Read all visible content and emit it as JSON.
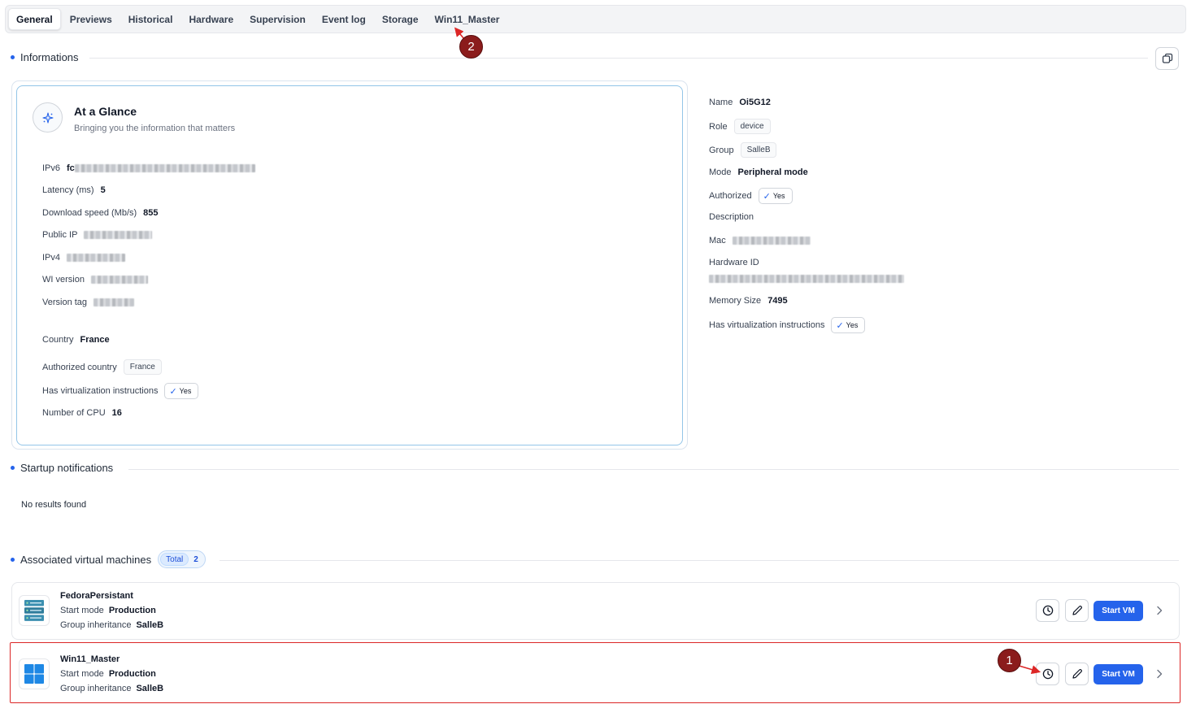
{
  "tabs": [
    "General",
    "Previews",
    "Historical",
    "Hardware",
    "Supervision",
    "Event log",
    "Storage",
    "Win11_Master"
  ],
  "sections": {
    "informations": "Informations",
    "startup": "Startup notifications",
    "vms": "Associated virtual machines"
  },
  "glance": {
    "title": "At a Glance",
    "subtitle": "Bringing you the information that matters",
    "ipv6_label": "IPv6",
    "ipv6_prefix": "fc",
    "latency_label": "Latency (ms)",
    "latency_value": "5",
    "download_label": "Download speed (Mb/s)",
    "download_value": "855",
    "public_ip_label": "Public IP",
    "ipv4_label": "IPv4",
    "wi_version_label": "WI version",
    "version_tag_label": "Version tag",
    "country_label": "Country",
    "country_value": "France",
    "authorized_country_label": "Authorized country",
    "authorized_country_value": "France",
    "virtualization_label": "Has virtualization instructions",
    "virtualization_value": "Yes",
    "cpu_label": "Number of CPU",
    "cpu_value": "16"
  },
  "device": {
    "name_label": "Name",
    "name_value": "Oi5G12",
    "role_label": "Role",
    "role_value": "device",
    "group_label": "Group",
    "group_value": "SalleB",
    "mode_label": "Mode",
    "mode_value": "Peripheral mode",
    "authorized_label": "Authorized",
    "authorized_value": "Yes",
    "description_label": "Description",
    "mac_label": "Mac",
    "hardware_id_label": "Hardware ID",
    "memory_label": "Memory Size",
    "memory_value": "7495",
    "virtualization_label": "Has virtualization instructions",
    "virtualization_value": "Yes"
  },
  "startup": {
    "empty_text": "No results found"
  },
  "vm_total": {
    "label": "Total",
    "count": "2"
  },
  "vms": [
    {
      "name": "FedoraPersistant",
      "start_mode_label": "Start mode",
      "start_mode": "Production",
      "group_label": "Group inheritance",
      "group": "SalleB",
      "start_label": "Start VM"
    },
    {
      "name": "Win11_Master",
      "start_mode_label": "Start mode",
      "start_mode": "Production",
      "group_label": "Group inheritance",
      "group": "SalleB",
      "start_label": "Start VM"
    }
  ],
  "annotations": [
    "1",
    "2"
  ],
  "colors": {
    "accent": "#2563eb",
    "highlight": "#dc2626",
    "badge": "#8b1c1c"
  }
}
